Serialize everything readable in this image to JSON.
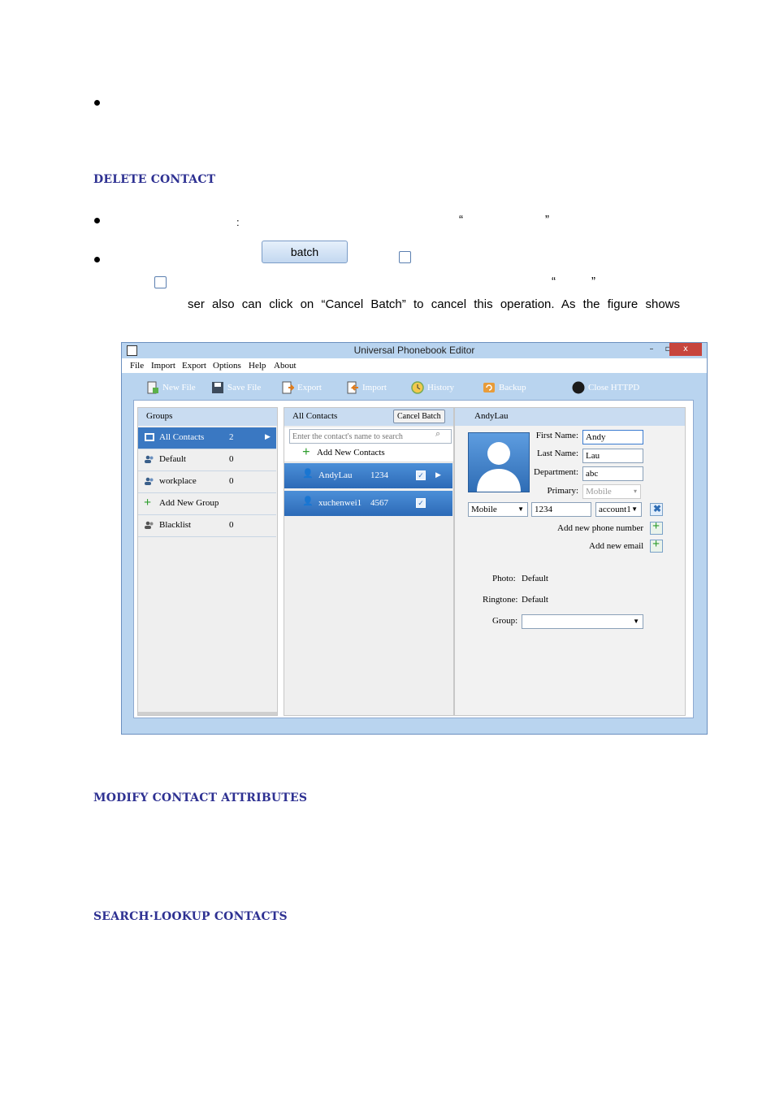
{
  "doc": {
    "headings": {
      "delete_contact": "DELETE CONTACT",
      "modify_attributes": "MODIFY CONTACT ATTRIBUTES",
      "search_lookup": "SEARCH·LOOKUP CONTACTS"
    },
    "fragments": {
      "colon": ":",
      "open_quote": "“",
      "close_quote": "”",
      "line3": "ser also can click on “Cancel Batch” to cancel this operation. As the figure shows"
    },
    "batch_button_label": "batch"
  },
  "app": {
    "title": "Universal Phonebook Editor",
    "window_buttons": {
      "minimize": "–",
      "maximize": "▫",
      "close": "x"
    },
    "menu": [
      "File",
      "Import",
      "Export",
      "Options",
      "Help",
      "About"
    ],
    "toolbar": [
      "New File",
      "Save File",
      "Export",
      "Import",
      "History",
      "Backup",
      "Close HTTPD"
    ],
    "groups_panel": {
      "header": "Groups",
      "rows": [
        {
          "label": "All Contacts",
          "count": "2"
        },
        {
          "label": "Default",
          "count": "0"
        },
        {
          "label": "workplace",
          "count": "0"
        },
        {
          "label": "Add New Group",
          "count": ""
        },
        {
          "label": "Blacklist",
          "count": "0"
        }
      ]
    },
    "contacts_panel": {
      "header": "All Contacts",
      "cancel_batch": "Cancel Batch",
      "search_placeholder": "Enter the contact's name to search",
      "add_new": "Add New Contacts",
      "rows": [
        {
          "name": "AndyLau",
          "number": "1234"
        },
        {
          "name": "xuchenwei1",
          "number": "4567"
        }
      ]
    },
    "detail_panel": {
      "header": "AndyLau",
      "first_name_label": "First Name:",
      "first_name_value": "Andy",
      "last_name_label": "Last Name:",
      "last_name_value": "Lau",
      "department_label": "Department:",
      "department_value": "abc",
      "primary_label": "Primary:",
      "primary_value": "Mobile",
      "phone_type": "Mobile",
      "phone_number": "1234",
      "account": "account1",
      "add_phone": "Add new phone number",
      "add_email": "Add new email",
      "photo_label": "Photo:",
      "photo_value": "Default",
      "ringtone_label": "Ringtone:",
      "ringtone_value": "Default",
      "group_label": "Group:",
      "group_value": ""
    }
  }
}
